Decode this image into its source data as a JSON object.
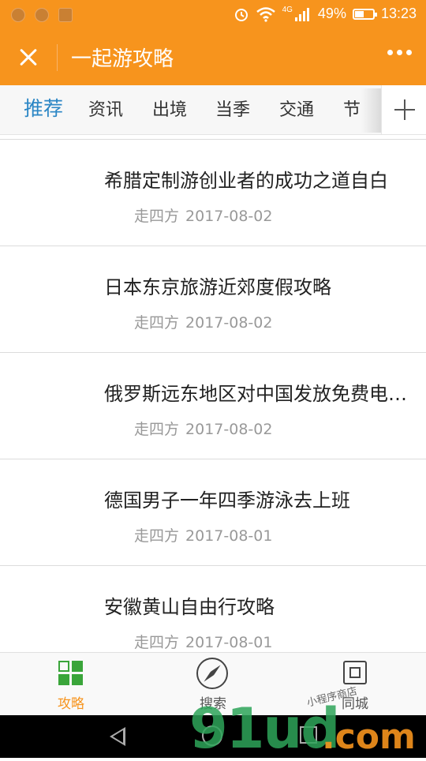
{
  "status_bar": {
    "network": "4G",
    "battery": "49%",
    "battery_level": 0.49,
    "time": "13:23"
  },
  "header": {
    "title": "一起游攻略",
    "close_icon": "close-icon",
    "more_icon": "more-dots-icon"
  },
  "tabs": [
    {
      "label": "推荐",
      "active": true
    },
    {
      "label": "资讯",
      "active": false
    },
    {
      "label": "出境",
      "active": false
    },
    {
      "label": "当季",
      "active": false
    },
    {
      "label": "交通",
      "active": false
    },
    {
      "label": "节",
      "active": false
    }
  ],
  "articles": [
    {
      "title": "希腊定制游创业者的成功之道自白",
      "source": "走四方",
      "date": "2017-08-02"
    },
    {
      "title": "日本东京旅游近郊度假攻略",
      "source": "走四方",
      "date": "2017-08-02"
    },
    {
      "title": "俄罗斯远东地区对中国发放免费电子签证",
      "source": "走四方",
      "date": "2017-08-02"
    },
    {
      "title": "德国男子一年四季游泳去上班",
      "source": "走四方",
      "date": "2017-08-01"
    },
    {
      "title": "安徽黄山自由行攻略",
      "source": "走四方",
      "date": "2017-08-01"
    }
  ],
  "bottom_nav": [
    {
      "label": "攻略",
      "icon": "grid-icon",
      "active": true
    },
    {
      "label": "搜索",
      "icon": "compass-icon",
      "active": false
    },
    {
      "label": "同城",
      "icon": "chip-icon",
      "active": false
    }
  ],
  "watermark": {
    "main": "91ud",
    "tld": ".com",
    "small": "小程序商店"
  },
  "colors": {
    "brand": "#f7941d",
    "tab_active": "#2b86c5",
    "nav_green": "#3aa53a"
  }
}
